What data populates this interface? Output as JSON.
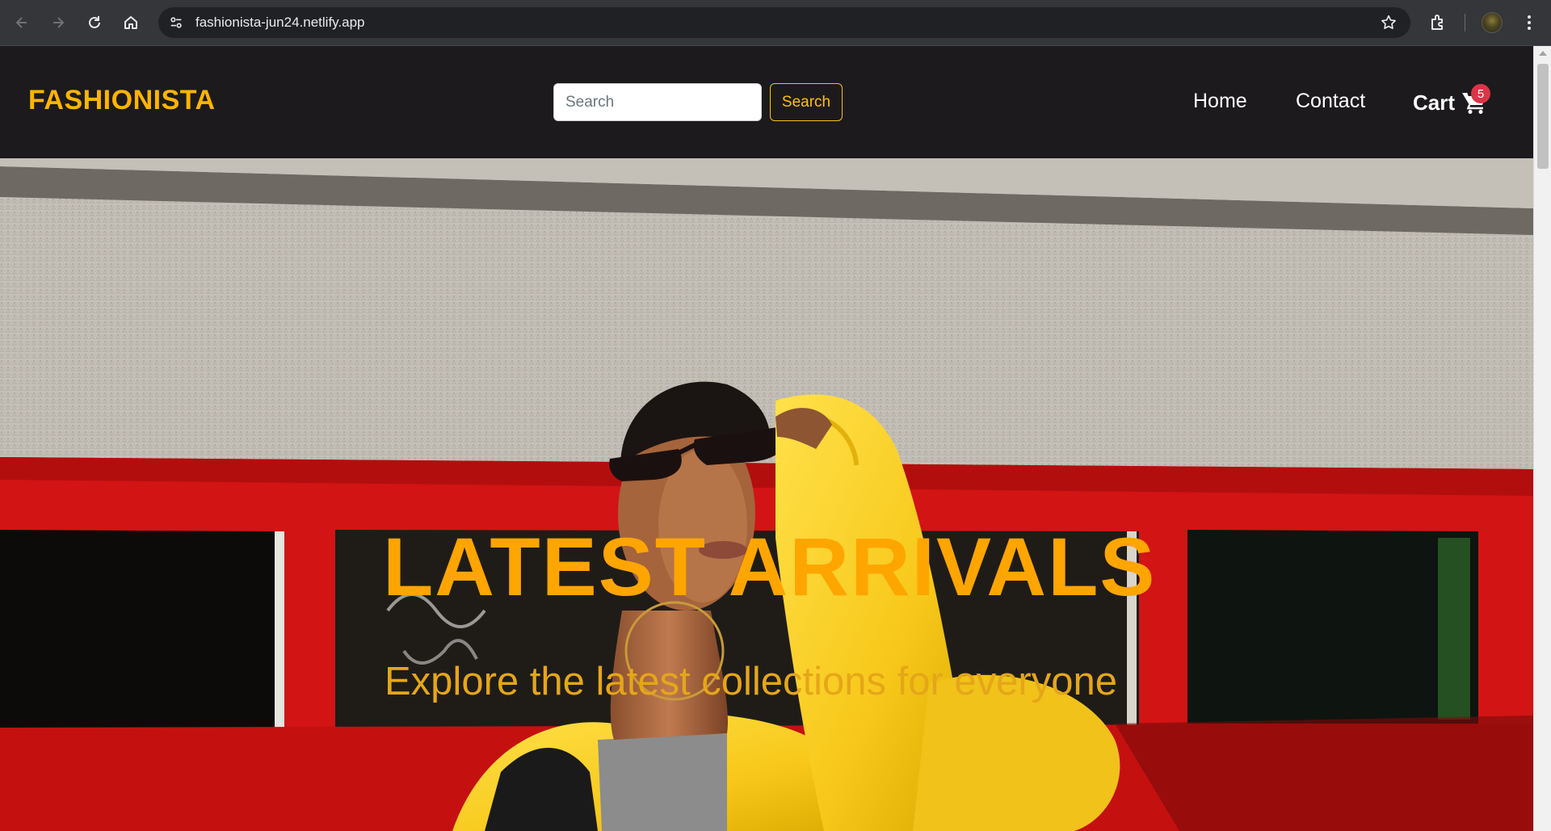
{
  "browser": {
    "url": "fashionista-jun24.netlify.app"
  },
  "navbar": {
    "brand": "FASHIONISTA",
    "search_placeholder": "Search",
    "search_button": "Search",
    "links": {
      "home": "Home",
      "contact": "Contact"
    },
    "cart_label": "Cart",
    "cart_count": "5"
  },
  "hero": {
    "title": "LATEST ARRIVALS",
    "subtitle": "Explore the latest collections for everyone"
  },
  "colors": {
    "brand": "#ffb400",
    "hero_title": "#ffa500",
    "hero_subtitle": "#e5a619",
    "search_button_border": "#ffc107",
    "cart_badge": "#dc3545",
    "navbar_bg": "#1c1a1d"
  }
}
